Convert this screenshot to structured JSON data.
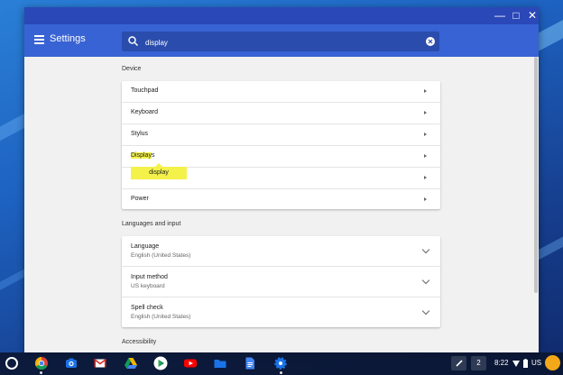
{
  "app": {
    "title": "Settings"
  },
  "window_controls": {
    "minimize": "—",
    "maximize": "□",
    "close": "✕"
  },
  "search": {
    "value": "display",
    "placeholder": ""
  },
  "sections": [
    {
      "heading": "Device",
      "rows": [
        {
          "label": "Touchpad"
        },
        {
          "label": "Keyboard"
        },
        {
          "label": "Stylus"
        },
        {
          "label_highlight": "Display",
          "label_rest": "s"
        },
        {
          "label_partial": "t"
        },
        {
          "label": "Power"
        }
      ]
    },
    {
      "heading": "Languages and input",
      "rows": [
        {
          "label": "Language",
          "sublabel": "English (United States)"
        },
        {
          "label": "Input method",
          "sublabel": "US keyboard"
        },
        {
          "label": "Spell check",
          "sublabel": "English (United States)"
        }
      ]
    },
    {
      "heading": "Accessibility"
    }
  ],
  "tooltip": {
    "text": "display"
  },
  "shelf": {
    "apps": [
      "chrome-icon",
      "camera-icon",
      "gmail-icon",
      "drive-icon",
      "play-store-icon",
      "youtube-icon",
      "files-icon",
      "docs-icon",
      "settings-icon"
    ],
    "tray": {
      "notifications": "2",
      "time": "8:22",
      "lang": "US"
    }
  },
  "colors": {
    "titlebar": "#2b48b8",
    "appbar": "#3863d4",
    "highlight": "#f4f24a"
  }
}
